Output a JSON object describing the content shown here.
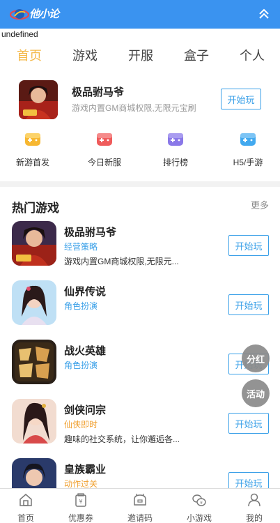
{
  "header": {
    "logo_text": "他小论",
    "colors": {
      "bar": "#3a93f0",
      "tab_active": "#f4b94a",
      "button": "#3aa0e8"
    }
  },
  "debug_text": "undefined",
  "tabs": [
    {
      "label": "首页",
      "active": true
    },
    {
      "label": "游戏",
      "active": false
    },
    {
      "label": "开服",
      "active": false
    },
    {
      "label": "盒子",
      "active": false
    },
    {
      "label": "个人",
      "active": false
    }
  ],
  "featured": {
    "title": "极品驸马爷",
    "desc": "游戏内置GM商城权限,无限元宝刷",
    "button": "开始玩"
  },
  "quick_links": [
    {
      "label": "新游首发",
      "icon": "gamepad-yellow-icon",
      "color": "#f7b731"
    },
    {
      "label": "今日新服",
      "icon": "gamepad-red-icon",
      "color": "#ef5b5b"
    },
    {
      "label": "排行榜",
      "icon": "gamepad-purple-icon",
      "color": "#8a78e8"
    },
    {
      "label": "H5/手游",
      "icon": "gamepad-blue-icon",
      "color": "#42a9ef"
    }
  ],
  "hot": {
    "title": "热门游戏",
    "more": "更多",
    "games": [
      {
        "name": "极品驸马爷",
        "category": "经营策略",
        "cat_color": "#3aa0e8",
        "desc": "游戏内置GM商城权限,无限元...",
        "button": "开始玩"
      },
      {
        "name": "仙界传说",
        "category": "角色扮演",
        "cat_color": "#3aa0e8",
        "desc": "",
        "button": "开始玩"
      },
      {
        "name": "战火英雄",
        "category": "角色扮演",
        "cat_color": "#3aa0e8",
        "desc": "",
        "button": "开始玩"
      },
      {
        "name": "剑侠问宗",
        "category": "仙侠即时",
        "cat_color": "#f0a030",
        "desc": "趣味的社交系统，让你邂逅各...",
        "button": "开始玩"
      },
      {
        "name": "皇族霸业",
        "category": "动作过关",
        "cat_color": "#f0a030",
        "desc": "",
        "button": "开始玩"
      }
    ]
  },
  "float_buttons": {
    "share": "分红",
    "event": "活动"
  },
  "bottom_nav": [
    {
      "label": "首页",
      "icon": "home-icon"
    },
    {
      "label": "优惠券",
      "icon": "coupon-icon"
    },
    {
      "label": "邀请码",
      "icon": "invite-icon"
    },
    {
      "label": "小游戏",
      "icon": "coins-icon"
    },
    {
      "label": "我的",
      "icon": "user-icon"
    }
  ]
}
